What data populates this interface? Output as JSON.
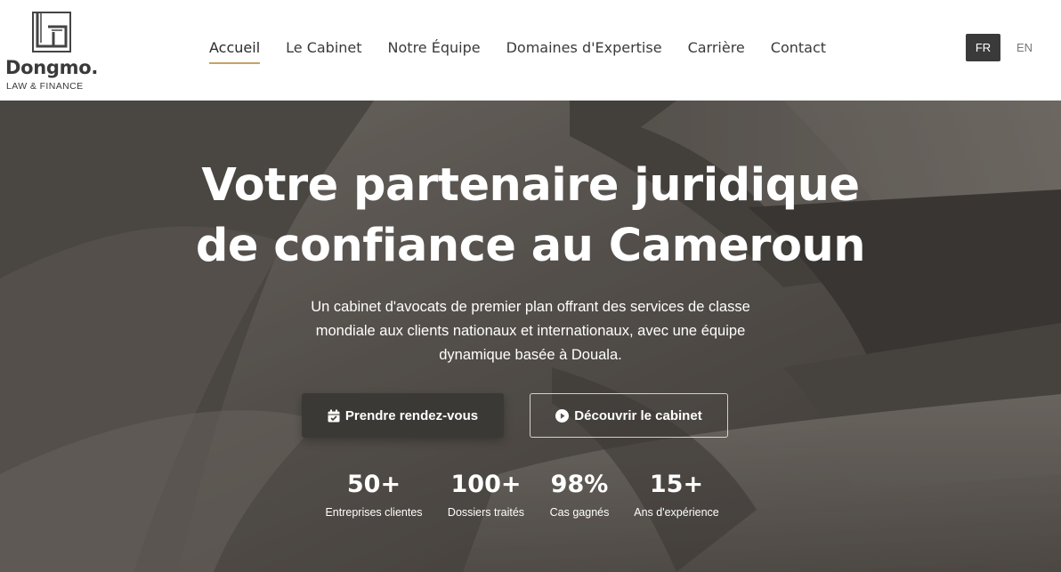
{
  "logo": {
    "name": "Dongmo.",
    "tagline": "LAW & FINANCE"
  },
  "nav": {
    "items": [
      {
        "label": "Accueil",
        "active": true
      },
      {
        "label": "Le Cabinet"
      },
      {
        "label": "Notre Équipe"
      },
      {
        "label": "Domaines d'Expertise"
      },
      {
        "label": "Carrière"
      },
      {
        "label": "Contact"
      }
    ]
  },
  "lang": {
    "fr": "FR",
    "en": "EN",
    "active": "FR"
  },
  "hero": {
    "title_line1": "Votre partenaire juridique",
    "title_line2": "de confiance au Cameroun",
    "subtitle": "Un cabinet d'avocats de premier plan offrant des services de classe mondiale aux clients nationaux et internationaux, avec une équipe dynamique basée à Douala.",
    "primary_button": {
      "label": "Prendre rendez-vous",
      "icon": "calendar-check-icon"
    },
    "secondary_button": {
      "label": "Découvrir le cabinet",
      "icon": "play-circle-icon"
    }
  },
  "stats": [
    {
      "value": "50+",
      "label": "Entreprises clientes"
    },
    {
      "value": "100+",
      "label": "Dossiers traités"
    },
    {
      "value": "98%",
      "label": "Cas gagnés"
    },
    {
      "value": "15+",
      "label": "Ans d'expérience"
    }
  ],
  "colors": {
    "accent": "#c8a265",
    "dark": "#3a3a3a",
    "button_dark": "#3b3936"
  }
}
